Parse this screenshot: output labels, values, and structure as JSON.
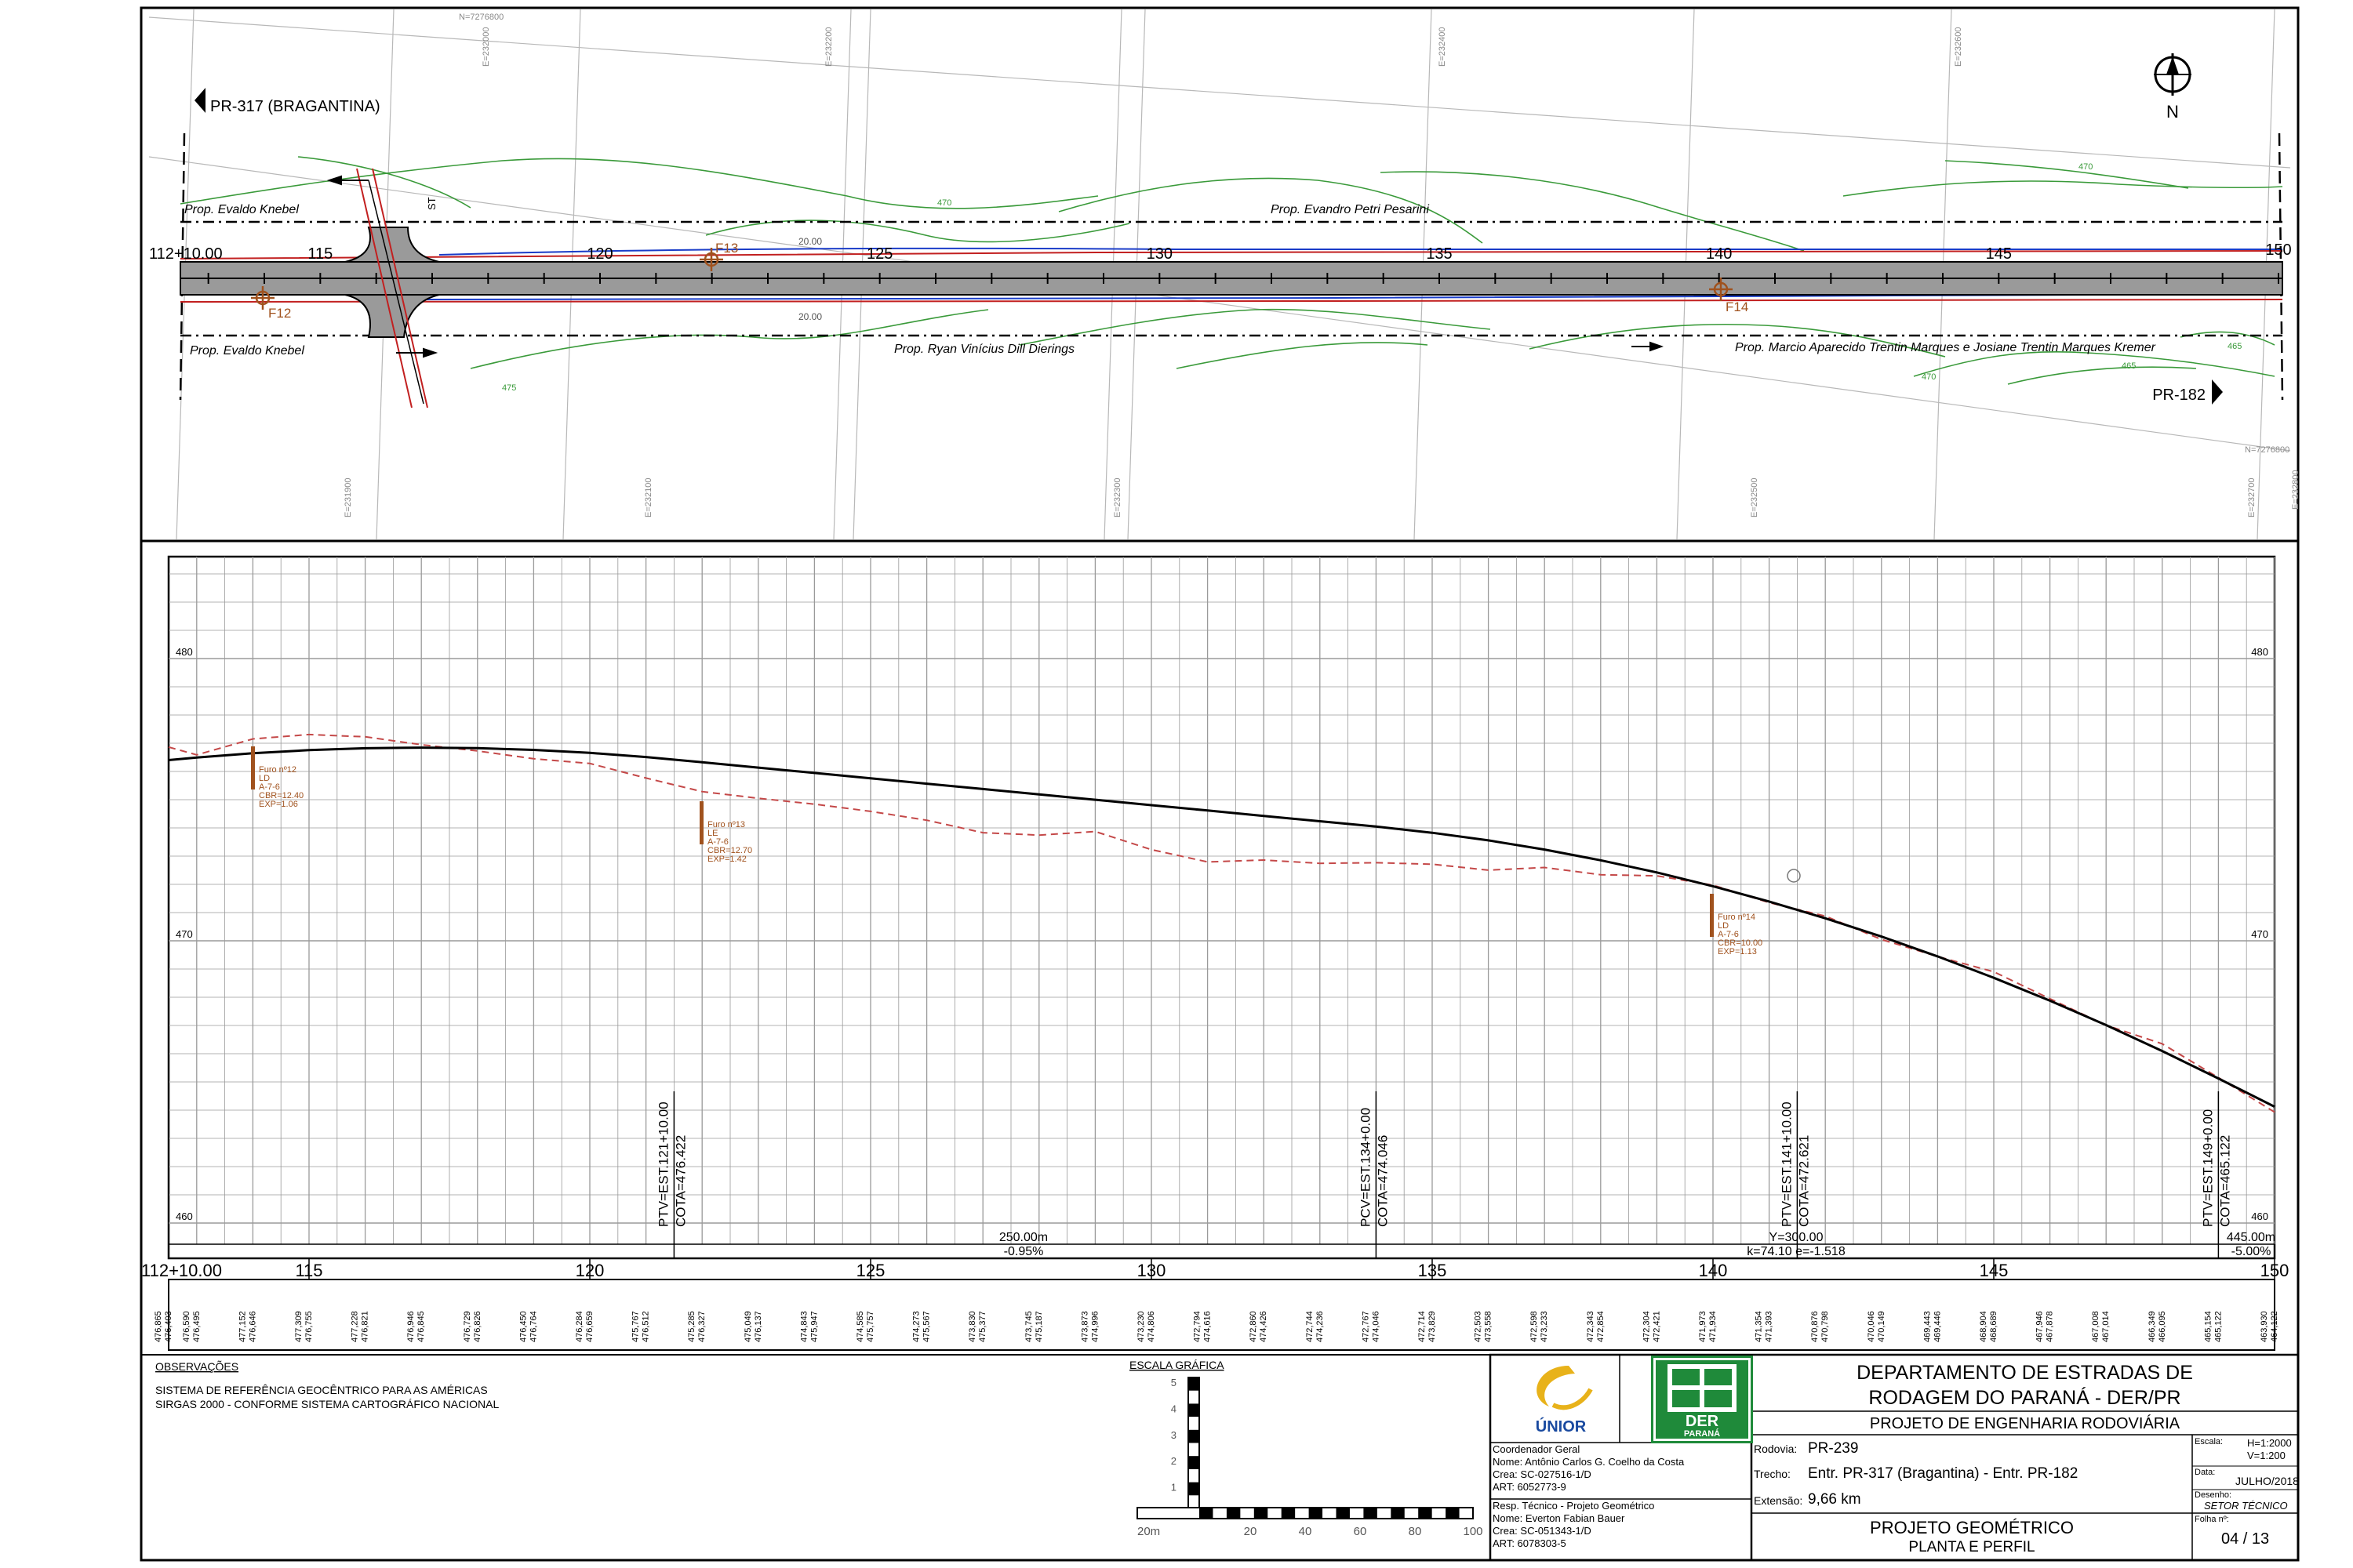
{
  "colors": {
    "road_fill": "#9a9a9a",
    "contour": "#3a9a3a",
    "survey_red": "#c22020",
    "survey_blue": "#1a3cc8",
    "borehole": "#a0521e",
    "terrain_dashed": "#c44848",
    "grid": "#9a9a9a",
    "der_green": "#1f8a3a",
    "unior_yellow": "#e8b21a",
    "unior_blue": "#1a4aa0"
  },
  "plan": {
    "north_label": "N",
    "direction_left": "PR-317 (BRAGANTINA)",
    "direction_right": "PR-182",
    "start_station": "112+10.00",
    "end_station": "150",
    "stations": [
      "115",
      "120",
      "125",
      "130",
      "135",
      "140",
      "145"
    ],
    "owners_top": [
      "Prop. Evaldo Knebel",
      "Prop. Evandro Petri Pesarini"
    ],
    "owners_bottom": [
      "Prop. Evaldo Knebel",
      "Prop. Ryan Vinícius Dill Dierings",
      "Prop. Marcio Aparecido Trentin Marques e Josiane Trentin Marques Kremer"
    ],
    "boreholes": [
      "F12",
      "F13",
      "F14"
    ],
    "st_label": "ST",
    "offset_labels": [
      "20.00",
      "20.00"
    ],
    "grid_labels": [
      "N=7276800",
      "N=7276800",
      "E=231900",
      "E=232000",
      "E=232100",
      "E=232200",
      "E=232300",
      "E=232400",
      "E=232500",
      "E=232600",
      "E=232700",
      "E=232800"
    ],
    "contour_labels": [
      "470",
      "475",
      "470",
      "465",
      "470",
      "465"
    ]
  },
  "profile": {
    "elevation_labels": [
      "480",
      "470",
      "460"
    ],
    "station_labels": [
      "112+10.00",
      "115",
      "120",
      "125",
      "130",
      "135",
      "140",
      "145",
      "150"
    ],
    "pi_labels": [
      {
        "station": "PTV=EST.121+10.00",
        "cota": "COTA=476.422"
      },
      {
        "station": "PCV=EST.134+0.00",
        "cota": "COTA=474.046"
      },
      {
        "station": "PTV=EST.141+10.00",
        "cota": "COTA=472.621"
      },
      {
        "station": "PTV=EST.149+0.00",
        "cota": "COTA=465.122"
      }
    ],
    "segments": [
      {
        "length": "250.00m",
        "grade": "-0.95%"
      },
      {
        "length": "445.00m",
        "grade": "-5.00%"
      }
    ],
    "curve": {
      "y": "Y=300.00",
      "params": "k=74.10  e=-1.518"
    },
    "boreholes": [
      {
        "lines": [
          "Furo nº12",
          "LD",
          "A-7-6",
          "CBR=12.40",
          "EXP=1.06"
        ]
      },
      {
        "lines": [
          "Furo nº13",
          "LE",
          "A-7-6",
          "CBR=12.70",
          "EXP=1.42"
        ]
      },
      {
        "lines": [
          "Furo nº14",
          "LD",
          "A-7-6",
          "CBR=10.00",
          "EXP=1.13"
        ]
      }
    ],
    "elevations_row": [
      "476,865",
      "476,403",
      "476,590",
      "476,495",
      "477,152",
      "476,646",
      "477,309",
      "476,755",
      "477,228",
      "476,821",
      "476,946",
      "476,845",
      "476,729",
      "476,826",
      "476,450",
      "476,764",
      "476,284",
      "476,659",
      "475,767",
      "476,512",
      "475,285",
      "476,327",
      "475,049",
      "476,137",
      "474,843",
      "475,947",
      "474,585",
      "475,757",
      "474,273",
      "475,567",
      "473,830",
      "475,377",
      "473,745",
      "475,187",
      "473,873",
      "474,996",
      "473,230",
      "474,806",
      "472,794",
      "474,616",
      "472,860",
      "474,426",
      "472,744",
      "474,236",
      "472,767",
      "474,046",
      "472,714",
      "473,829",
      "472,503",
      "473,558",
      "472,598",
      "473,233",
      "472,343",
      "472,854",
      "472,304",
      "472,421",
      "471,973",
      "471,934",
      "471,354",
      "471,393",
      "470,876",
      "470,798",
      "470,046",
      "470,149",
      "469,443",
      "469,446",
      "468,904",
      "468,689",
      "467,946",
      "467,878",
      "467,008",
      "467,014",
      "466,349",
      "466,095",
      "465,154",
      "465,122",
      "463,930",
      "464,122"
    ]
  },
  "notes": {
    "title": "OBSERVAÇÕES",
    "lines": [
      "SISTEMA DE REFERÊNCIA GEOCÊNTRICO PARA AS AMÉRICAS",
      "SIRGAS 2000 - CONFORME SISTEMA CARTOGRÁFICO NACIONAL"
    ]
  },
  "scale_bar": {
    "title": "ESCALA GRÁFICA",
    "v_labels": [
      "5",
      "4",
      "3",
      "2",
      "1"
    ],
    "h_labels": [
      "20m",
      "20",
      "40",
      "60",
      "80",
      "100"
    ]
  },
  "title_block": {
    "org_line1": "DEPARTAMENTO DE ESTRADAS DE",
    "org_line2": "RODAGEM DO PARANÁ - DER/PR",
    "project_type": "PROJETO DE ENGENHARIA RODOVIÁRIA",
    "rodovia_label": "Rodovia:",
    "rodovia_value": "PR-239",
    "trecho_label": "Trecho:",
    "trecho_value": "Entr. PR-317 (Bragantina) - Entr. PR-182",
    "extensao_label": "Extensão:",
    "extensao_value": "9,66 km",
    "drawing_title": "PROJETO GEOMÉTRICO",
    "drawing_subtitle": "PLANTA E PERFIL",
    "escala_label": "Escala:",
    "escala_h": "H=1:2000",
    "escala_v": "V=1:200",
    "data_label": "Data:",
    "data_value": "JULHO/2018",
    "desenho_label": "Desenho:",
    "desenho_value": "SETOR TÉCNICO",
    "folha_label": "Folha nº:",
    "folha_value": "04 / 13",
    "unior_name": "ÚNIOR",
    "der_name": "DER",
    "der_sub": "PARANÁ",
    "coord_title": "Coordenador Geral",
    "coord_nome": "Nome:  Antônio Carlos G. Coelho da Costa",
    "coord_crea": "Crea:    SC-027516-1/D",
    "coord_art": "ART:     6052773-9",
    "resp_title": "Resp. Técnico - Projeto Geométrico",
    "resp_nome": "Nome:  Everton Fabian Bauer",
    "resp_crea": "Crea:    SC-051343-1/D",
    "resp_art": "ART:     6078303-5"
  }
}
